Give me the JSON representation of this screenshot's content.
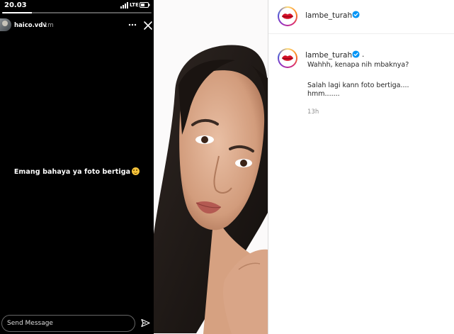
{
  "status_bar": {
    "time": "20.03",
    "network": "LTE",
    "signal_icon": "signal-bars-icon",
    "battery_icon": "battery-icon"
  },
  "story": {
    "username": "haico.vdv",
    "age": "1m",
    "caption": "Emang bahaya ya foto bertiga",
    "caption_emoji": "grinning-face-emoji",
    "progress_fraction": 0.2,
    "more_icon": "more-horizontal-icon",
    "close_icon": "close-icon",
    "send_placeholder": "Send Message",
    "send_icon": "paper-plane-icon"
  },
  "photo": {
    "subject": "portrait-photo"
  },
  "post": {
    "username": "lambe_turah",
    "verified_icon": "verified-badge-icon",
    "avatar_icon": "red-lips-icon"
  },
  "comment": {
    "username": "lambe_turah",
    "suffix": ".",
    "lines": [
      "Wahhh, kenapa nih mbaknya?",
      "Salah lagi kann foto bertiga....",
      "hmm......."
    ],
    "timestamp": "13h"
  },
  "colors": {
    "verified_blue": "#0095f6",
    "lips_red": "#d31027",
    "text_dark": "#262626",
    "text_muted": "#8e8e8e"
  }
}
